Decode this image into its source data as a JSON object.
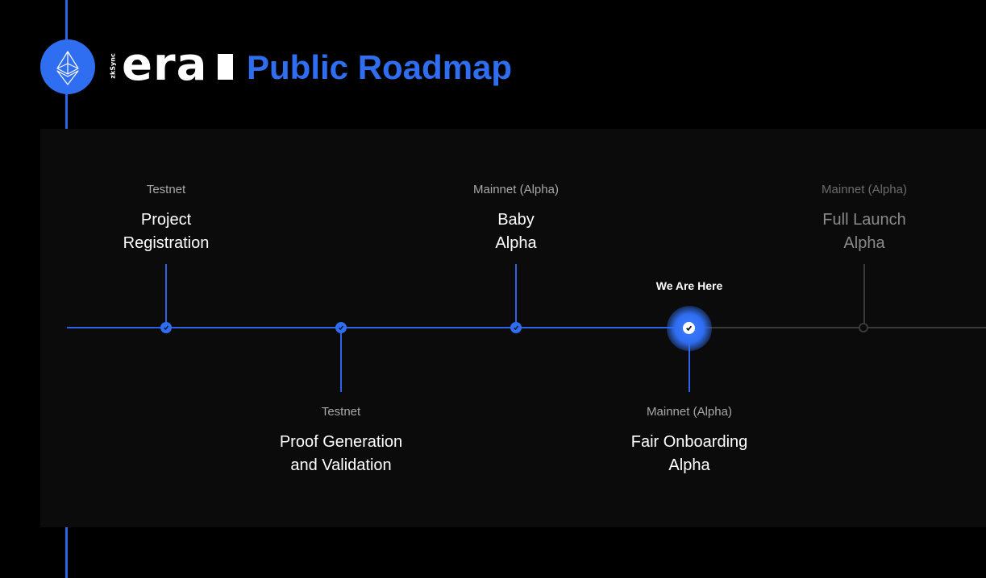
{
  "header": {
    "brand_small": "zkSync",
    "brand_name": "era",
    "title": "Public Roadmap",
    "logo_icon": "ethereum-icon"
  },
  "colors": {
    "accent": "#2f6ef0",
    "line_done": "#2f63e6",
    "line_todo": "#3a3a3a",
    "background": "#000000",
    "panel": "#0b0b0b"
  },
  "timeline": {
    "current_label": "We Are Here",
    "milestones": [
      {
        "category": "Testnet",
        "title_line1": "Project",
        "title_line2": "Registration",
        "status": "done",
        "position": "top"
      },
      {
        "category": "Testnet",
        "title_line1": "Proof Generation",
        "title_line2": "and Validation",
        "status": "done",
        "position": "bottom"
      },
      {
        "category": "Mainnet (Alpha)",
        "title_line1": "Baby",
        "title_line2": "Alpha",
        "status": "done",
        "position": "top"
      },
      {
        "category": "Mainnet (Alpha)",
        "title_line1": "Fair Onboarding",
        "title_line2": "Alpha",
        "status": "current",
        "position": "bottom"
      },
      {
        "category": "Mainnet (Alpha)",
        "title_line1": "Full Launch",
        "title_line2": "Alpha",
        "status": "upcoming",
        "position": "top"
      }
    ]
  }
}
